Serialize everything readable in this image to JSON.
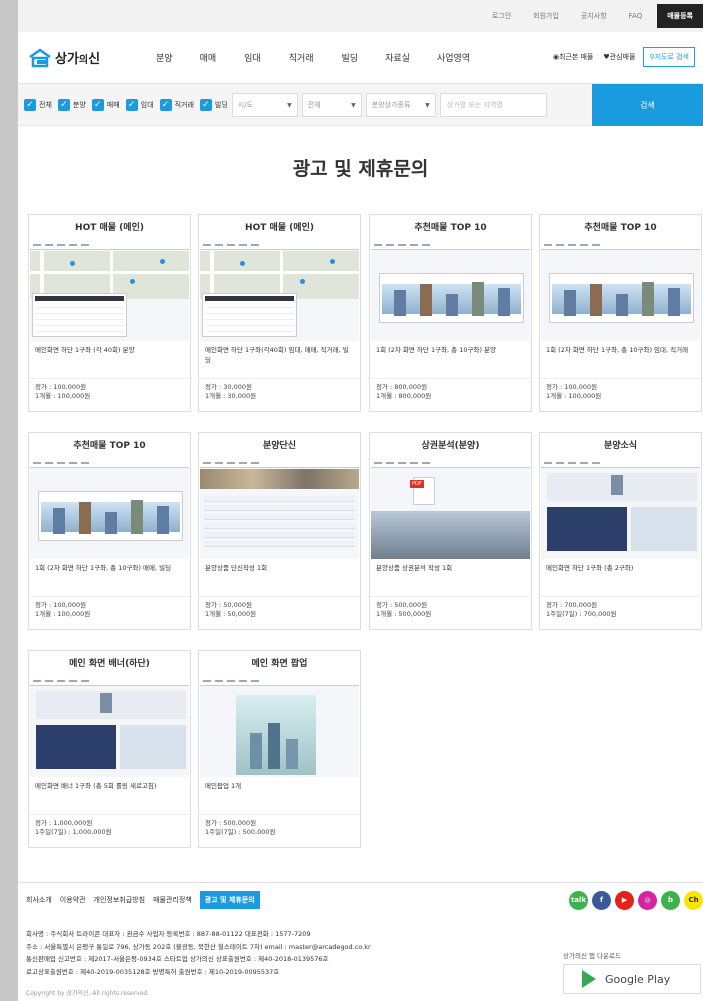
{
  "topbar": {
    "login": "로그인",
    "signup": "회원가입",
    "notice": "공지사항",
    "faq": "FAQ",
    "register": "매물등록"
  },
  "logo": {
    "text_main": "상가",
    "text_sub": "의",
    "text_end": "신"
  },
  "nav": [
    "분양",
    "매매",
    "임대",
    "직거래",
    "빌딩",
    "자료실",
    "사업영역"
  ],
  "header_right": {
    "recent": "최근본 매물",
    "favorite": "관심매물",
    "map_search": "지도로 검색"
  },
  "filter": {
    "checks": [
      "전체",
      "분양",
      "매매",
      "임대",
      "직거래",
      "빌딩"
    ],
    "region_select": "시/도",
    "district_select": "전체",
    "type_select": "분양상가종류",
    "search_placeholder": "상가명 또는 지역명",
    "search_button": "검색"
  },
  "page_title": "광고 및 제휴문의",
  "cards": [
    {
      "title": "HOT 매물 (메인)",
      "desc": "메인화면 하단 1구좌 (각 40회) 분양",
      "price1": "정가 : 100,000원",
      "price2": "1개월 : 100,000원",
      "thumb": "map"
    },
    {
      "title": "HOT 매물 (메인)",
      "desc": "메인화면 하단 1구좌(각40회) 임대, 매매, 직거래, 빌딩",
      "price1": "정가 : 30,000원",
      "price2": "1개월 : 30,000원",
      "thumb": "map"
    },
    {
      "title": "추천매물 TOP 10",
      "desc": "1회 (2차 화면 하단 1구좌, 총 10구좌) 분양",
      "price1": "정가 : 800,000원",
      "price2": "1개월 : 800,000원",
      "thumb": "banner"
    },
    {
      "title": "추천매물 TOP 10",
      "desc": "1회 (2차 화면 하단 1구좌, 총 10구좌) 임대, 직거래",
      "price1": "정가 : 100,000원",
      "price2": "1개월 : 100,000원",
      "thumb": "banner"
    },
    {
      "title": "추천매물 TOP 10",
      "desc": "1회 (2차 화면 하단 1구좌, 총 10구좌) 매매, 빌딩",
      "price1": "정가 : 100,000원",
      "price2": "1개월 : 100,000원",
      "thumb": "banner"
    },
    {
      "title": "분양단신",
      "desc": "분양상품 단신작성 1회",
      "price1": "정가 : 50,000원",
      "price2": "1개월 : 50,000원",
      "thumb": "list"
    },
    {
      "title": "상권분석(분양)",
      "desc": "분양상품 상권분석 작성 1회",
      "price1": "정가 : 500,000원",
      "price2": "1개월 : 500,000원",
      "thumb": "pdf"
    },
    {
      "title": "분양소식",
      "desc": "메인화면 하단 1구좌 (총 2구좌)",
      "price1": "정가 : 700,000원",
      "price2": "1주일(7일) : 700,000원",
      "thumb": "news"
    },
    {
      "title": "메인 화면 배너(하단)",
      "desc": "메인화면 배너 1구좌 (총 5회 롤링 새로고침)",
      "price1": "정가 : 1,000,000원",
      "price2": "1주일(7일) : 1,000,000원",
      "thumb": "news"
    },
    {
      "title": "메인 화면 팝업",
      "desc": "메인팝업 1개",
      "price1": "정가 : 500,000원",
      "price2": "1주일(7일) : 500,000원",
      "thumb": "popup"
    }
  ],
  "footer": {
    "links": [
      "회사소개",
      "이용약관",
      "개인정보취급방침",
      "매물관리정책",
      "광고 및 제휴문의"
    ],
    "sns": [
      {
        "name": "talk",
        "label": "talk",
        "color": "#3bb34a"
      },
      {
        "name": "facebook",
        "label": "f",
        "color": "#3b5998"
      },
      {
        "name": "youtube",
        "label": "▶",
        "color": "#e62117"
      },
      {
        "name": "instagram",
        "label": "◎",
        "color": "#d6249f"
      },
      {
        "name": "band",
        "label": "b",
        "color": "#3db24b"
      },
      {
        "name": "kakao",
        "label": "Ch",
        "color": "#f7e600"
      }
    ],
    "info": [
      "회사명 : 주식회사 트라이콘    대표자 : 권금수    사업자 등록번호 : 887-88-01122    대표전화 : 1577-7209",
      "주소 : 서울특별시 은평구 통일로 796, 상가동 202호 (불광동, 북한산 힐스테이트 7차)    email : master@arcadegod.co.kr",
      "통신판매업 신고번호 : 제2017-서울은평-0934호    스타트업 상가의신 상표출원번호 : 제40-2018-0139576호",
      "로고상표출원번호 : 제40-2019-0035128호    방명특허 출원번호 : 제10-2019-0095537호"
    ],
    "copyright": "Copyright by 상가의신. All rights reserved.",
    "app_download": "상가의신 앱 다운로드",
    "google_play": "Google Play"
  }
}
